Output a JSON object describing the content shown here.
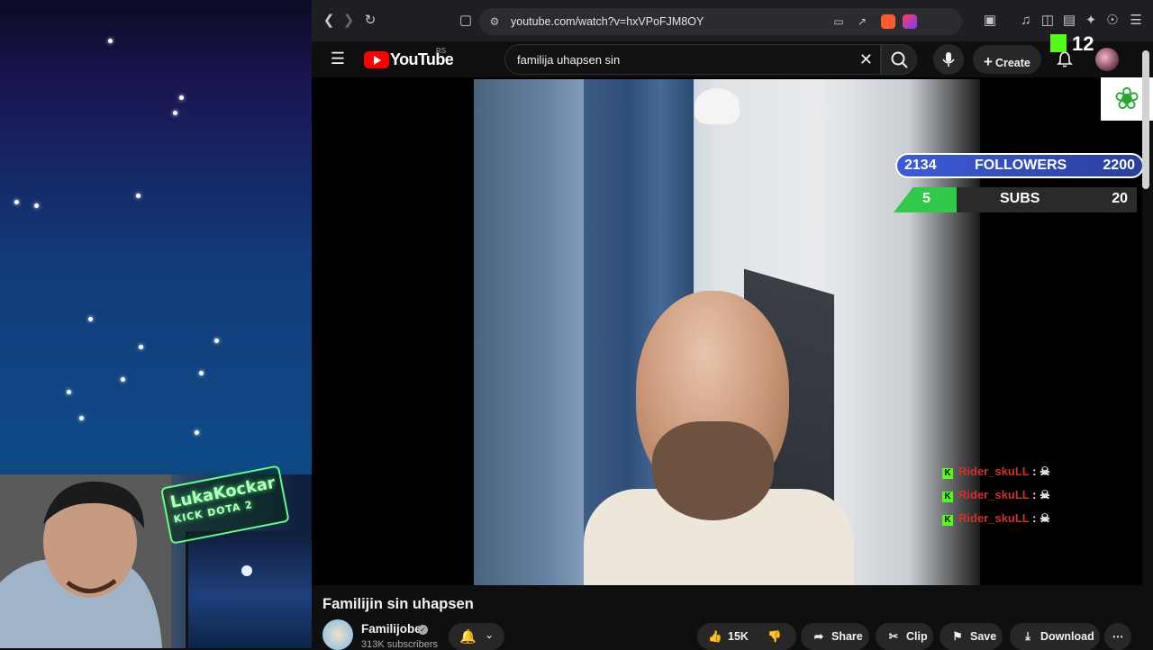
{
  "browser": {
    "url": "youtube.com/watch?v=hxVPoFJM8OY"
  },
  "masthead": {
    "brand": "YouTube",
    "country": "RS",
    "search_value": "familija uhapsen sin",
    "create_label": "Create"
  },
  "overlay": {
    "kick_count": "12",
    "followers": {
      "current": "2134",
      "label": "FOLLOWERS",
      "goal": "2200"
    },
    "subs": {
      "current": "5",
      "label": "SUBS",
      "goal": "20"
    },
    "chat": [
      {
        "user": "Rider_skuLL",
        "sep": ":"
      },
      {
        "user": "Rider_skuLL",
        "sep": ":"
      },
      {
        "user": "Rider_skuLL",
        "sep": ":"
      }
    ],
    "webcam_sign": {
      "line1": "LukaKockar",
      "line2": "KICK  DOTA 2"
    }
  },
  "video": {
    "title": "Familijin sin uhapsen",
    "channel": "Familijobe",
    "subscribers": "313K subscribers"
  },
  "actions": {
    "likes": "15K",
    "share": "Share",
    "clip": "Clip",
    "save": "Save",
    "download": "Download"
  },
  "icons": [
    "back-icon",
    "forward-icon",
    "reload-icon",
    "bookmark-icon",
    "site-settings-icon",
    "menu-icon",
    "search-icon",
    "clear-icon",
    "mic-icon",
    "plus-icon",
    "bell-icon",
    "like-icon",
    "dislike-icon",
    "share-icon",
    "clip-icon",
    "save-icon",
    "download-icon",
    "more-icon"
  ]
}
